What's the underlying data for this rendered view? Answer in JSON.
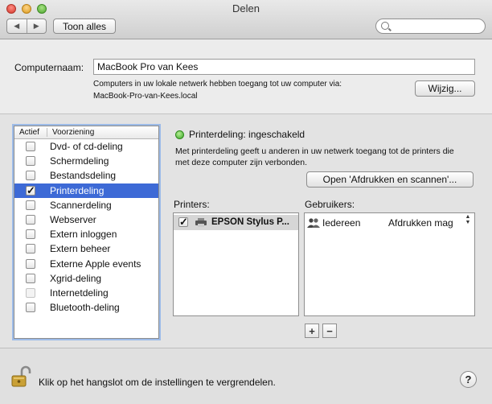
{
  "window": {
    "title": "Delen"
  },
  "toolbar": {
    "back_glyph": "◀",
    "forward_glyph": "▶",
    "show_all_label": "Toon alles",
    "search_placeholder": ""
  },
  "computer": {
    "name_label": "Computernaam:",
    "name_value": "MacBook Pro van Kees",
    "access_text": "Computers in uw lokale netwerk hebben toegang tot uw computer via:",
    "local_address": "MacBook-Pro-van-Kees.local",
    "edit_button": "Wijzig..."
  },
  "services": {
    "header_active": "Actief",
    "header_service": "Voorziening",
    "items": [
      {
        "label": "Dvd- of cd-deling",
        "checked": false,
        "selected": false,
        "dim": false
      },
      {
        "label": "Schermdeling",
        "checked": false,
        "selected": false,
        "dim": false
      },
      {
        "label": "Bestandsdeling",
        "checked": false,
        "selected": false,
        "dim": false
      },
      {
        "label": "Printerdeling",
        "checked": true,
        "selected": true,
        "dim": false
      },
      {
        "label": "Scannerdeling",
        "checked": false,
        "selected": false,
        "dim": false
      },
      {
        "label": "Webserver",
        "checked": false,
        "selected": false,
        "dim": false
      },
      {
        "label": "Extern inloggen",
        "checked": false,
        "selected": false,
        "dim": false
      },
      {
        "label": "Extern beheer",
        "checked": false,
        "selected": false,
        "dim": false
      },
      {
        "label": "Externe Apple events",
        "checked": false,
        "selected": false,
        "dim": false
      },
      {
        "label": "Xgrid-deling",
        "checked": false,
        "selected": false,
        "dim": false
      },
      {
        "label": "Internetdeling",
        "checked": false,
        "selected": false,
        "dim": true
      },
      {
        "label": "Bluetooth-deling",
        "checked": false,
        "selected": false,
        "dim": false
      }
    ]
  },
  "detail": {
    "status_text": "Printerdeling: ingeschakeld",
    "status_color": "#3aa626",
    "description_line1": "Met printerdeling geeft u anderen in uw netwerk toegang tot de printers die",
    "description_line2": "met deze computer zijn verbonden.",
    "open_button": "Open 'Afdrukken en scannen'...",
    "printers_label": "Printers:",
    "users_label": "Gebruikers:",
    "printers": [
      {
        "name": "EPSON Stylus P...",
        "checked": true,
        "icon": "printer-icon"
      }
    ],
    "users": [
      {
        "name": "Iedereen",
        "permission": "Afdrukken mag",
        "icon": "users-icon"
      }
    ],
    "add_glyph": "+",
    "remove_glyph": "−"
  },
  "footer": {
    "lock_text": "Klik op het hangslot om de instellingen te vergrendelen.",
    "help_glyph": "?"
  },
  "colors": {
    "selection": "#3d6ad6",
    "focus_ring": "#9dbbe8"
  }
}
